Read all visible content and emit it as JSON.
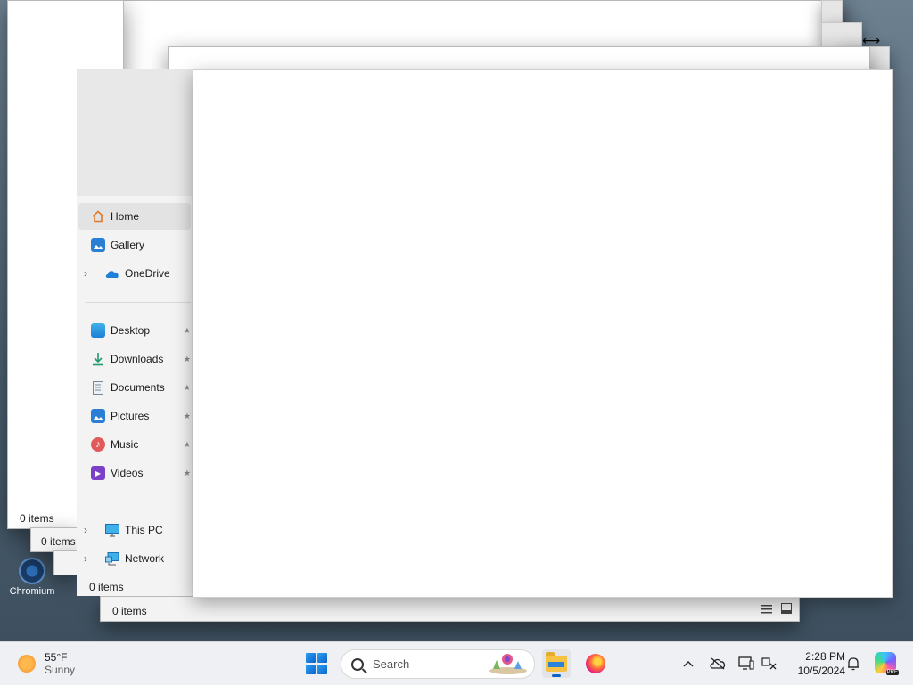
{
  "nav": {
    "items": [
      {
        "label": "Home",
        "icon": "home-icon",
        "chevron": false,
        "selected": true,
        "pinned": false
      },
      {
        "label": "Gallery",
        "icon": "gallery-icon",
        "chevron": false,
        "selected": false,
        "pinned": false
      },
      {
        "label": "OneDrive",
        "icon": "onedrive-icon",
        "chevron": true,
        "selected": false,
        "pinned": false
      },
      {
        "label": "Desktop",
        "icon": "desktop-icon",
        "chevron": false,
        "selected": false,
        "pinned": true
      },
      {
        "label": "Downloads",
        "icon": "downloads-icon",
        "chevron": false,
        "selected": false,
        "pinned": true
      },
      {
        "label": "Documents",
        "icon": "documents-icon",
        "chevron": false,
        "selected": false,
        "pinned": true
      },
      {
        "label": "Pictures",
        "icon": "pictures-icon",
        "chevron": false,
        "selected": false,
        "pinned": true
      },
      {
        "label": "Music",
        "icon": "music-icon",
        "chevron": false,
        "selected": false,
        "pinned": true
      },
      {
        "label": "Videos",
        "icon": "videos-icon",
        "chevron": false,
        "selected": false,
        "pinned": true
      },
      {
        "label": "This PC",
        "icon": "this-pc-icon",
        "chevron": true,
        "selected": false,
        "pinned": false
      },
      {
        "label": "Network",
        "icon": "network-icon",
        "chevron": true,
        "selected": false,
        "pinned": false
      }
    ]
  },
  "windows": {
    "back_status": "0 items",
    "mid_status": "0 items",
    "front_status": "0 items",
    "bottom_status": "0 items"
  },
  "desktop": {
    "icon_label": "Chromium"
  },
  "taskbar": {
    "weather_temp": "55°F",
    "weather_desc": "Sunny",
    "search_placeholder": "Search",
    "time": "2:28 PM",
    "date": "10/5/2024",
    "copilot_badge": "PRE"
  },
  "colors": {
    "accent": "#0a63c9",
    "taskbar_bg": "#eef0f3",
    "nav_bg": "#f3f3f3"
  }
}
